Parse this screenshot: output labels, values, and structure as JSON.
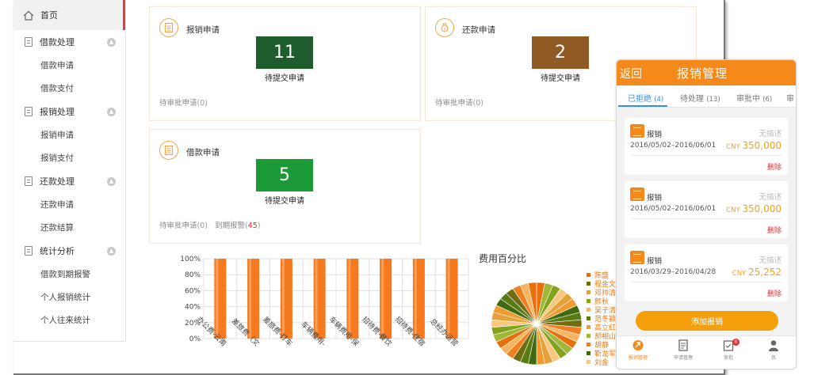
{
  "sidebar": {
    "home": "首页",
    "groups": [
      {
        "label": "借款处理",
        "items": [
          "借款申请",
          "借款支付"
        ]
      },
      {
        "label": "报销处理",
        "items": [
          "报销申请",
          "报销支付"
        ]
      },
      {
        "label": "还款处理",
        "items": [
          "还款申请",
          "还款结算"
        ]
      },
      {
        "label": "统计分析",
        "items": [
          "借款到期报警",
          "个人报销统计",
          "个人往来统计"
        ]
      }
    ]
  },
  "cards": {
    "reimburse": {
      "title": "报销申请",
      "count": "11",
      "count_label": "待提交申请",
      "pending_label": "待审批申请",
      "pending_open": "(",
      "pending_count": "0",
      "pending_close": ")",
      "color": "#1f5e2c"
    },
    "repay": {
      "title": "还款申请",
      "count": "2",
      "count_label": "待提交申请",
      "pending_label": "待审批申请",
      "pending_open": "(",
      "pending_count": "0",
      "pending_close": ")",
      "color": "#8f5a24"
    },
    "loan": {
      "title": "借款申请",
      "count": "5",
      "count_label": "待提交申请",
      "pending_label": "待审批申请",
      "pending_open": "(",
      "pending_count": "0",
      "pending_close": ")",
      "due_label": "到期报警",
      "due_open": "(",
      "due_count": "45",
      "due_close": ")",
      "color": "#1b9a37"
    }
  },
  "chart_data": [
    {
      "type": "bar",
      "categories": [
        "办公费-云南",
        "差旅费（文",
        "差旅费-打车",
        "车辆费用-",
        "车辆费用-保",
        "招待费-餐饮",
        "招待费-住宿",
        "总经办运营"
      ],
      "values": [
        100,
        100,
        100,
        100,
        100,
        100,
        100,
        100
      ],
      "ylim": [
        0,
        100
      ],
      "yticks": [
        "0%",
        "20%",
        "40%",
        "60%",
        "80%",
        "100%"
      ],
      "bar_color": "#f5791f",
      "grid": true
    },
    {
      "type": "pie",
      "title": "费用百分比",
      "legend": [
        "陈盛",
        "程金文员",
        "邓帅清",
        "颜秋",
        "吴子清",
        "范冬颖",
        "高立红",
        "郝相山",
        "胡静",
        "靳龙军",
        "刘金"
      ],
      "legend_colors": [
        "#e8700c",
        "#6e6e10",
        "#f09a30",
        "#84a31c",
        "#f5b562",
        "#5a7a12",
        "#e8a03a",
        "#a0b838",
        "#f07f20",
        "#3f6a10",
        "#f8c880"
      ],
      "legend_placement": "right"
    }
  ],
  "phone": {
    "back": "返回",
    "title": "报销管理",
    "tabs": [
      {
        "label": "已拒绝",
        "count": "(4)"
      },
      {
        "label": "待处理",
        "count": "(13)"
      },
      {
        "label": "审批中",
        "count": "(6)"
      },
      {
        "label": "审",
        "count": ""
      }
    ],
    "items": [
      {
        "type": "报销",
        "desc": "无描述",
        "dates": "2016/05/02–2016/06/01",
        "cur": "CNY",
        "amount": "350,000",
        "delete": "删除"
      },
      {
        "type": "报销",
        "desc": "无描述",
        "dates": "2016/05/02–2016/06/01",
        "cur": "CNY",
        "amount": "350,000",
        "delete": "删除"
      },
      {
        "type": "报销",
        "desc": "无描述",
        "dates": "2016/03/29–2016/04/28",
        "cur": "CNY",
        "amount": "25,252",
        "delete": "删除"
      }
    ],
    "add_button": "添加报销",
    "nav": [
      {
        "label": "报销管理",
        "icon": "reimburse-icon"
      },
      {
        "label": "申请管理",
        "icon": "document-icon"
      },
      {
        "label": "审批",
        "icon": "approve-icon",
        "badge": "8"
      },
      {
        "label": "我",
        "icon": "person-icon"
      }
    ]
  },
  "colors": {
    "accent": "#f5891a",
    "tab_active": "#3b8fd8",
    "sidebar_active": "#d94040"
  }
}
